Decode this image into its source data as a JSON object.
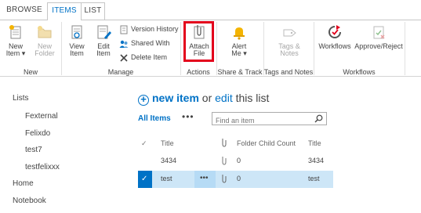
{
  "tabs": {
    "browse": "BROWSE",
    "items": "ITEMS",
    "list": "LIST"
  },
  "ribbon": {
    "new_item": [
      "New",
      "Item ▾"
    ],
    "new_folder": [
      "New",
      "Folder"
    ],
    "view_item": [
      "View",
      "Item"
    ],
    "edit_item": [
      "Edit",
      "Item"
    ],
    "version_history": "Version History",
    "shared_with": "Shared With",
    "delete_item": "Delete Item",
    "attach_file": [
      "Attach",
      "File"
    ],
    "alert_me": [
      "Alert",
      "Me ▾"
    ],
    "tags_notes": [
      "Tags &",
      "Notes"
    ],
    "workflows": "Workflows",
    "approve_reject": "Approve/Reject",
    "groups": {
      "new": "New",
      "manage": "Manage",
      "actions": "Actions",
      "share_track": "Share & Track",
      "tags_notes": "Tags and Notes",
      "workflows": "Workflows"
    }
  },
  "nav": {
    "items": [
      "Lists",
      "Fexternal",
      "Felixdo",
      "test7",
      "testfelixxx",
      "Home",
      "Notebook"
    ]
  },
  "main": {
    "new_item": "new item",
    "or": "or",
    "edit": "edit",
    "this_list": "this list",
    "view_all": "All Items",
    "view_more": "•••",
    "search_placeholder": "Find an item"
  },
  "table": {
    "headers": {
      "check": "✓",
      "title": "Title",
      "folder_child_count": "Folder Child Count",
      "title2": "Title"
    },
    "rows": [
      {
        "title": "3434",
        "count": "0",
        "title2": "3434",
        "selected": false
      },
      {
        "title": "test",
        "ellipsis": "•••",
        "count": "0",
        "title2": "test",
        "selected": true
      }
    ]
  },
  "colors": {
    "accent": "#0072c6",
    "highlight": "#e3001b",
    "selected_row": "#cde6f7"
  }
}
